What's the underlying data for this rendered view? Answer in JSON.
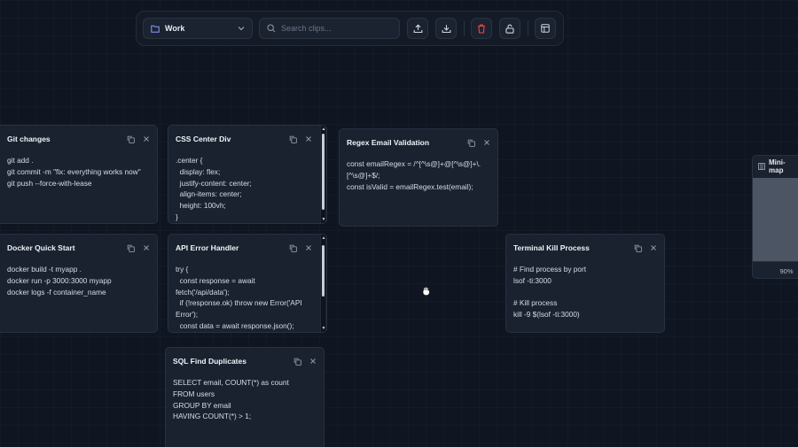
{
  "toolbar": {
    "workspace": "Work",
    "search_placeholder": "Search clips..."
  },
  "cards": {
    "git": {
      "title": "Git changes",
      "content": "git add .\ngit commit -m \"fix: everything works now\"\ngit push --force-with-lease"
    },
    "css": {
      "title": "CSS Center Div",
      "content": ".center {\n  display: flex;\n  justify-content: center;\n  align-items: center;\n  height: 100vh;\n}"
    },
    "regex": {
      "title": "Regex Email Validation",
      "content": "const emailRegex = /^[^\\s@]+@[^\\s@]+\\.\n[^\\s@]+$/;\nconst isValid = emailRegex.test(email);"
    },
    "docker": {
      "title": "Docker Quick Start",
      "content": "docker build -t myapp .\ndocker run -p 3000:3000 myapp\ndocker logs -f container_name"
    },
    "api": {
      "title": "API Error Handler",
      "content": "try {\n  const response = await\nfetch('/api/data');\n  if (!response.ok) throw new Error('API\nError');\n  const data = await response.json();"
    },
    "terminal": {
      "title": "Terminal Kill Process",
      "content": "# Find process by port\nlsof -ti:3000\n\n# Kill process\nkill -9 $(lsof -ti:3000)"
    },
    "sql": {
      "title": "SQL Find Duplicates",
      "content": "SELECT email, COUNT(*) as count\nFROM users\nGROUP BY email\nHAVING COUNT(*) > 1;"
    }
  },
  "minimap": {
    "title": "Mini-map",
    "zoom": "90%"
  },
  "colors": {
    "background": "#0f1521",
    "card": "#1a2230",
    "accent": "#8c9cff",
    "danger": "#ef4444"
  }
}
